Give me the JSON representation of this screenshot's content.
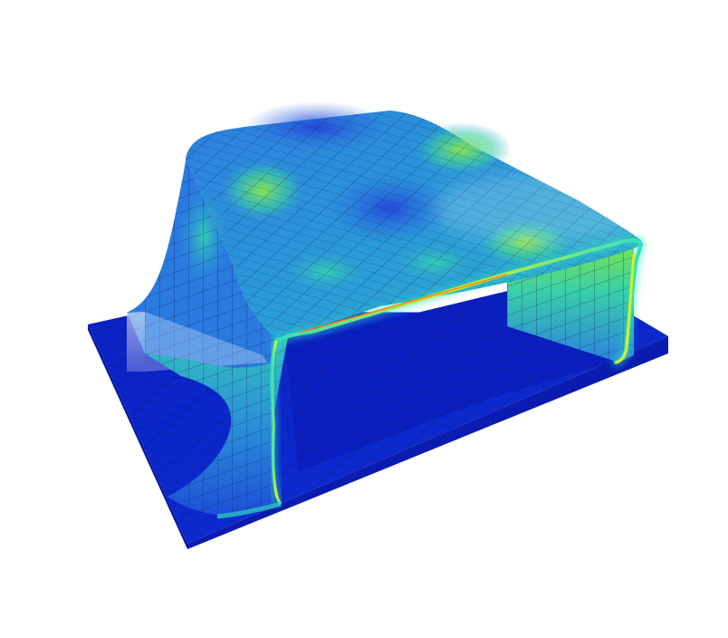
{
  "scene": {
    "subject": "sheet-metal-stamping-result",
    "colormap": [
      "#0a1fc8",
      "#1f5fe0",
      "#2aa0d8",
      "#2fd0b0",
      "#7ee04a",
      "#d8f020",
      "#ff7a10"
    ],
    "base_color": "#0d2bd0",
    "mesh_line_color": "#0a1650"
  }
}
